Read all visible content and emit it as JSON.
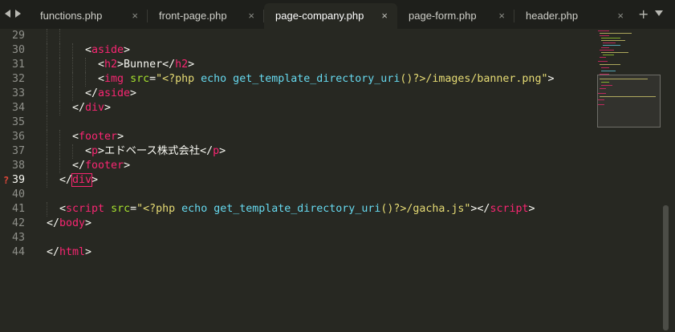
{
  "tabs": [
    {
      "label": "functions.php",
      "close": "×",
      "active": false
    },
    {
      "label": "front-page.php",
      "close": "×",
      "active": false
    },
    {
      "label": "page-company.php",
      "close": "×",
      "active": true
    },
    {
      "label": "page-form.php",
      "close": "×",
      "active": false
    },
    {
      "label": "header.php",
      "close": "×",
      "active": false
    }
  ],
  "tab_actions": {
    "add": "+"
  },
  "editor": {
    "error_marker": "?",
    "lines": [
      {
        "num": "29",
        "indent": 2,
        "parts": []
      },
      {
        "num": "30",
        "indent": 3,
        "parts": [
          [
            "p",
            "<"
          ],
          [
            "t",
            "aside"
          ],
          [
            "p",
            ">"
          ]
        ]
      },
      {
        "num": "31",
        "indent": 4,
        "parts": [
          [
            "p",
            "<"
          ],
          [
            "t",
            "h2"
          ],
          [
            "p",
            ">"
          ],
          [
            "x",
            "Bunner"
          ],
          [
            "p",
            "</"
          ],
          [
            "t",
            "h2"
          ],
          [
            "p",
            ">"
          ]
        ]
      },
      {
        "num": "32",
        "indent": 4,
        "parts": [
          [
            "p",
            "<"
          ],
          [
            "t",
            "img"
          ],
          [
            "p",
            " "
          ],
          [
            "a",
            "src"
          ],
          [
            "p",
            "="
          ],
          [
            "s",
            "\"<?php "
          ],
          [
            "k",
            "echo get_template_directory_uri"
          ],
          [
            "s",
            "()?>/images/banner.png\""
          ],
          [
            "p",
            ">"
          ]
        ]
      },
      {
        "num": "33",
        "indent": 3,
        "parts": [
          [
            "p",
            "</"
          ],
          [
            "t",
            "aside"
          ],
          [
            "p",
            ">"
          ]
        ]
      },
      {
        "num": "34",
        "indent": 2,
        "parts": [
          [
            "p",
            "</"
          ],
          [
            "t",
            "div"
          ],
          [
            "p",
            ">"
          ]
        ]
      },
      {
        "num": "35",
        "indent": 1,
        "parts": []
      },
      {
        "num": "36",
        "indent": 2,
        "parts": [
          [
            "p",
            "<"
          ],
          [
            "t",
            "footer"
          ],
          [
            "p",
            ">"
          ]
        ]
      },
      {
        "num": "37",
        "indent": 3,
        "parts": [
          [
            "p",
            "<"
          ],
          [
            "t",
            "p"
          ],
          [
            "p",
            ">"
          ],
          [
            "x",
            "エドベース株式会社"
          ],
          [
            "p",
            "</"
          ],
          [
            "t",
            "p"
          ],
          [
            "p",
            ">"
          ]
        ]
      },
      {
        "num": "38",
        "indent": 2,
        "parts": [
          [
            "p",
            "</"
          ],
          [
            "t",
            "footer"
          ],
          [
            "p",
            ">"
          ]
        ]
      },
      {
        "num": "39",
        "indent": 1,
        "error": true,
        "current": true,
        "parts": [
          [
            "p",
            "</"
          ],
          [
            "b",
            "div"
          ],
          [
            "p",
            ">"
          ]
        ]
      },
      {
        "num": "40",
        "indent": 0,
        "parts": []
      },
      {
        "num": "41",
        "indent": 1,
        "parts": [
          [
            "p",
            "<"
          ],
          [
            "t",
            "script"
          ],
          [
            "p",
            " "
          ],
          [
            "a",
            "src"
          ],
          [
            "p",
            "="
          ],
          [
            "s",
            "\"<?php "
          ],
          [
            "k",
            "echo get_template_directory_uri"
          ],
          [
            "s",
            "()?>/gacha.js\""
          ],
          [
            "p",
            "></"
          ],
          [
            "t",
            "script"
          ],
          [
            "p",
            ">"
          ]
        ]
      },
      {
        "num": "42",
        "indent": 0,
        "parts": [
          [
            "p",
            "</"
          ],
          [
            "t",
            "body"
          ],
          [
            "p",
            ">"
          ]
        ]
      },
      {
        "num": "43",
        "indent": 0,
        "parts": []
      },
      {
        "num": "44",
        "indent": 0,
        "parts": [
          [
            "p",
            "</"
          ],
          [
            "t",
            "html"
          ],
          [
            "p",
            ">"
          ]
        ]
      }
    ]
  },
  "colors": {
    "background": "#272822",
    "tag": "#f92672",
    "attribute": "#a6e22e",
    "string": "#e6db74",
    "keyword": "#66d9ef",
    "text": "#f8f8f2",
    "gutter": "#8f908a"
  },
  "icons": {
    "nav_back": "arrow-left-icon",
    "nav_forward": "arrow-right-icon",
    "tab_close": "close-icon",
    "add_tab": "plus-icon",
    "tab_menu": "chevron-down-icon",
    "error": "question-mark-icon"
  }
}
